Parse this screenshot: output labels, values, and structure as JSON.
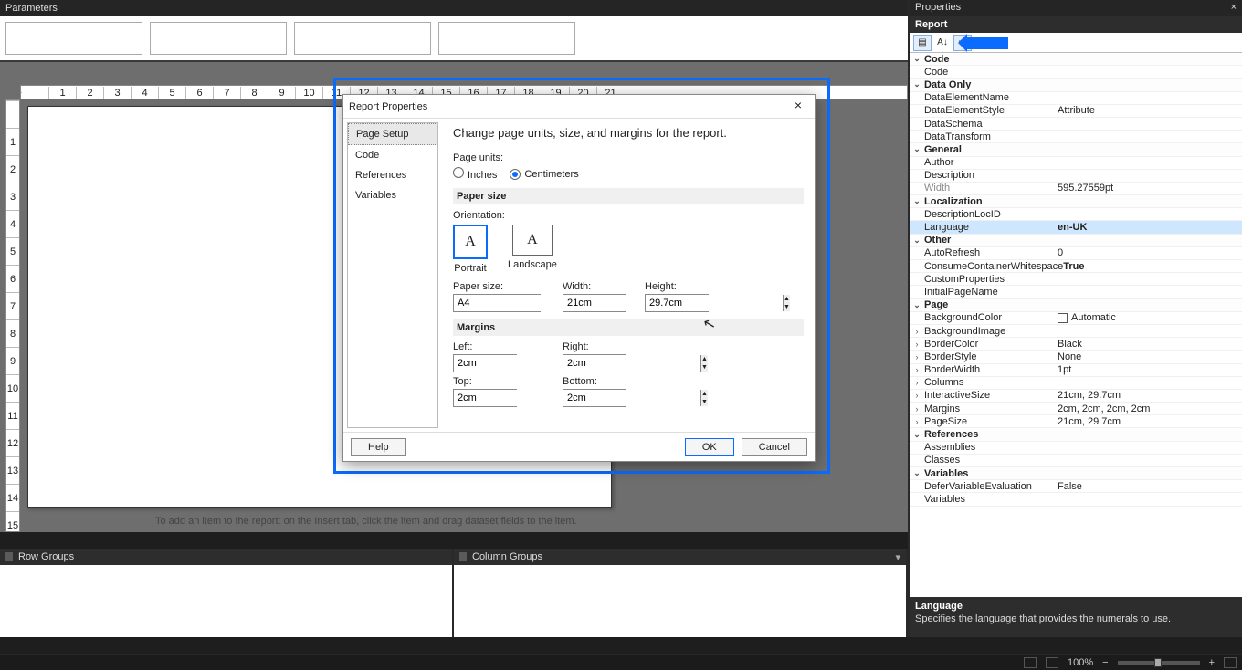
{
  "parameters": {
    "title": "Parameters"
  },
  "ruler_h": [
    "",
    "1",
    "2",
    "3",
    "4",
    "5",
    "6",
    "7",
    "8",
    "9",
    "10",
    "11",
    "12",
    "13",
    "14",
    "15",
    "16",
    "17",
    "18",
    "19",
    "20",
    "21"
  ],
  "ruler_v": [
    "",
    "1",
    "2",
    "3",
    "4",
    "5",
    "6",
    "7",
    "8",
    "9",
    "10",
    "11",
    "12",
    "13",
    "14",
    "15"
  ],
  "design_hint": "To add an item to the report: on the Insert tab, click the item and drag dataset fields to the item.",
  "dialog": {
    "title": "Report Properties",
    "nav": {
      "page_setup": "Page Setup",
      "code": "Code",
      "references": "References",
      "variables": "Variables"
    },
    "heading": "Change page units, size, and margins for the report.",
    "page_units_label": "Page units:",
    "units": {
      "inches": "Inches",
      "centimeters": "Centimeters"
    },
    "paper_size_header": "Paper size",
    "orientation_label": "Orientation:",
    "orientation": {
      "portrait": "Portrait",
      "landscape": "Landscape"
    },
    "paper_size_label": "Paper size:",
    "paper_size_value": "A4",
    "width_label": "Width:",
    "width_value": "21cm",
    "height_label": "Height:",
    "height_value": "29.7cm",
    "margins_header": "Margins",
    "margins": {
      "left_label": "Left:",
      "left": "2cm",
      "right_label": "Right:",
      "right": "2cm",
      "top_label": "Top:",
      "top": "2cm",
      "bottom_label": "Bottom:",
      "bottom": "2cm"
    },
    "buttons": {
      "help": "Help",
      "ok": "OK",
      "cancel": "Cancel"
    }
  },
  "row_groups": "Row Groups",
  "column_groups": "Column Groups",
  "properties": {
    "title": "Properties",
    "object": "Report",
    "desc_title": "Language",
    "desc_body": "Specifies the language that provides the numerals to use.",
    "rows": [
      {
        "t": "cat",
        "tw": "v",
        "nm": "Code"
      },
      {
        "t": "p",
        "nm": "Code",
        "vl": ""
      },
      {
        "t": "cat",
        "tw": "v",
        "nm": "Data Only"
      },
      {
        "t": "p",
        "nm": "DataElementName",
        "vl": ""
      },
      {
        "t": "p",
        "nm": "DataElementStyle",
        "vl": "Attribute"
      },
      {
        "t": "p",
        "nm": "DataSchema",
        "vl": ""
      },
      {
        "t": "p",
        "nm": "DataTransform",
        "vl": ""
      },
      {
        "t": "cat",
        "tw": "v",
        "nm": "General"
      },
      {
        "t": "p",
        "nm": "Author",
        "vl": ""
      },
      {
        "t": "p",
        "nm": "Description",
        "vl": ""
      },
      {
        "t": "p",
        "nm": "Width",
        "vl": "595.27559pt",
        "dim": true
      },
      {
        "t": "cat",
        "tw": "v",
        "nm": "Localization"
      },
      {
        "t": "p",
        "nm": "DescriptionLocID",
        "vl": ""
      },
      {
        "t": "p",
        "nm": "Language",
        "vl": "en-UK",
        "sel": true,
        "bold": true
      },
      {
        "t": "cat",
        "tw": "v",
        "nm": "Other"
      },
      {
        "t": "p",
        "nm": "AutoRefresh",
        "vl": "0"
      },
      {
        "t": "p",
        "nm": "ConsumeContainerWhitespace",
        "vl": "True",
        "bold": true
      },
      {
        "t": "p",
        "nm": "CustomProperties",
        "vl": ""
      },
      {
        "t": "p",
        "nm": "InitialPageName",
        "vl": ""
      },
      {
        "t": "cat",
        "tw": "v",
        "nm": "Page"
      },
      {
        "t": "p",
        "nm": "BackgroundColor",
        "vl": "Automatic",
        "sw": true
      },
      {
        "t": "exp",
        "tw": ">",
        "nm": "BackgroundImage",
        "vl": ""
      },
      {
        "t": "exp",
        "tw": ">",
        "nm": "BorderColor",
        "vl": "Black"
      },
      {
        "t": "exp",
        "tw": ">",
        "nm": "BorderStyle",
        "vl": "None"
      },
      {
        "t": "exp",
        "tw": ">",
        "nm": "BorderWidth",
        "vl": "1pt"
      },
      {
        "t": "exp",
        "tw": ">",
        "nm": "Columns",
        "vl": ""
      },
      {
        "t": "exp",
        "tw": ">",
        "nm": "InteractiveSize",
        "vl": "21cm, 29.7cm"
      },
      {
        "t": "exp",
        "tw": ">",
        "nm": "Margins",
        "vl": "2cm, 2cm, 2cm, 2cm"
      },
      {
        "t": "exp",
        "tw": ">",
        "nm": "PageSize",
        "vl": "21cm, 29.7cm"
      },
      {
        "t": "cat",
        "tw": "v",
        "nm": "References"
      },
      {
        "t": "p",
        "nm": "Assemblies",
        "vl": ""
      },
      {
        "t": "p",
        "nm": "Classes",
        "vl": ""
      },
      {
        "t": "cat",
        "tw": "v",
        "nm": "Variables"
      },
      {
        "t": "p",
        "nm": "DeferVariableEvaluation",
        "vl": "False"
      },
      {
        "t": "p",
        "nm": "Variables",
        "vl": ""
      }
    ]
  },
  "status": {
    "zoom": "100%"
  }
}
